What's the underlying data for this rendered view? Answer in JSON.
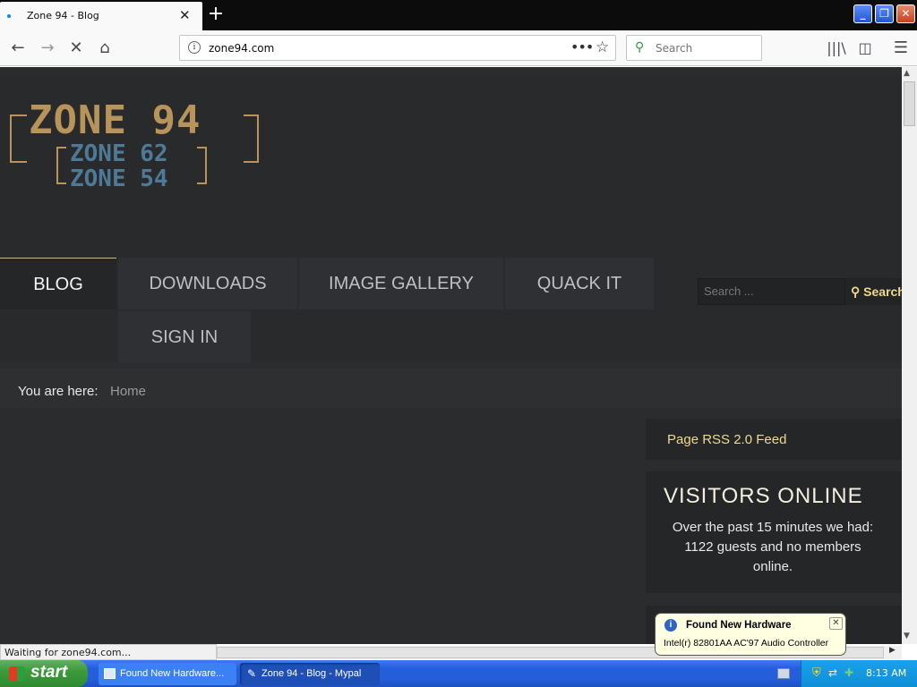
{
  "browser": {
    "tab_title": "Zone 94 - Blog",
    "url": "zone94.com",
    "search_placeholder": "Search",
    "status_text": "Waiting for zone94.com..."
  },
  "site": {
    "logo_main": "ZONE 94",
    "logo_sub1": "ZONE 62",
    "logo_sub2": "ZONE 54",
    "nav": [
      {
        "label": "BLOG",
        "active": true
      },
      {
        "label": "DOWNLOADS"
      },
      {
        "label": "IMAGE GALLERY"
      },
      {
        "label": "QUACK IT"
      },
      {
        "label": "SIGN IN"
      }
    ],
    "search_placeholder": "Search ...",
    "search_button": "Search",
    "breadcrumb_label": "You are here:",
    "breadcrumb_home": "Home",
    "rss_link": "Page RSS 2.0 Feed",
    "visitors_title": "VISITORS ONLINE",
    "visitors_text": "Over the past 15 minutes we had: 1122 guests and no members online."
  },
  "taskbar": {
    "start_label": "start",
    "items": [
      {
        "label": "Found New Hardware..."
      },
      {
        "label": "Zone 94 - Blog - Mypal"
      }
    ],
    "clock": "8:13 AM"
  },
  "notification": {
    "title": "Found New Hardware",
    "body": "Intel(r) 82801AA AC'97 Audio Controller"
  },
  "colors": {
    "page_bg": "#2b2c2e",
    "logo_gold": "#b8935a",
    "logo_blue": "#4e7a97",
    "accent_yellow": "#f0d98c",
    "taskbar_blue": "#245edb"
  }
}
